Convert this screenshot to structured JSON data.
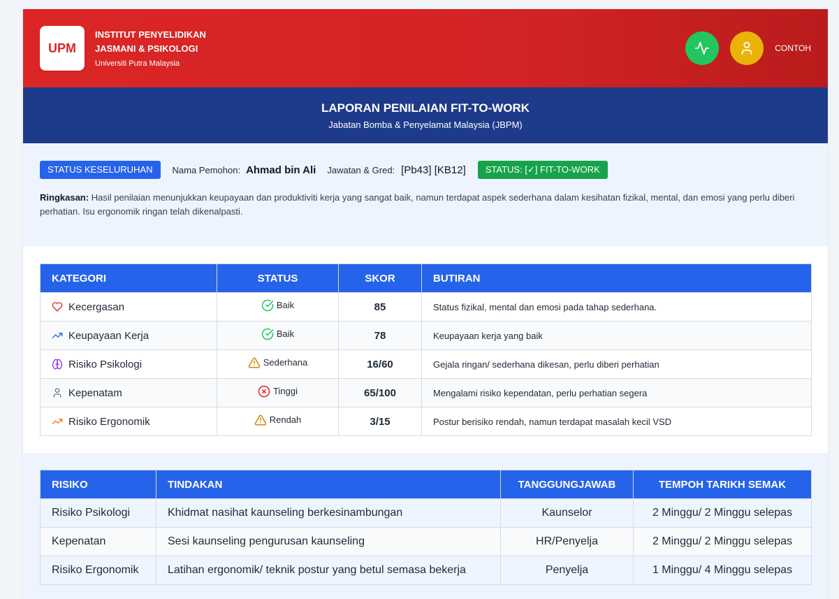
{
  "header": {
    "logo_text": "UPM",
    "institute_line1": "INSTITUT PENYELIDIKAN",
    "institute_line2": "JASMANI & PSIKOLOGI",
    "university": "Universiti Putra Malaysia",
    "activity_button_icon": "activity-icon",
    "profile_button_icon": "user-icon",
    "user_label": "CONTOH"
  },
  "report": {
    "title": "LAPORAN PENILAIAN FIT-TO-WORK",
    "subtitle": "Jabatan Bomba & Penyelamat Malaysia (JBPM)"
  },
  "overview": {
    "badge": "STATUS KESELURUHAN",
    "applicant_label": "Nama Pemohon:",
    "applicant_name": "Ahmad bin Ali",
    "position_label": "Jawatan & Gred:",
    "position_value": "[Pb43] [KB12]",
    "status_badge": "STATUS: [✓] FIT-TO-WORK",
    "summary_label": "Ringkasan:",
    "summary_text": "Hasil penilaian menunjukkan keupayaan dan produktiviti kerja yang sangat baik, namun terdapat aspek sederhana dalam kesihatan fizikal, mental, dan emosi yang perlu diberi perhatian. Isu ergonomik ringan telah dikenalpasti."
  },
  "assessment_table": {
    "headers": {
      "category": "KATEGORI",
      "status": "STATUS",
      "score": "SKOR",
      "details": "BUTIRAN"
    },
    "rows": [
      {
        "category": "Kecergasan",
        "category_icon": "heart-icon",
        "status": "Baik",
        "status_icon": "check-circle-icon",
        "score": "85",
        "details": "Status fizikal, mental dan emosi pada tahap sederhana."
      },
      {
        "category": "Keupayaan Kerja",
        "category_icon": "trending-up-icon",
        "status": "Baik",
        "status_icon": "check-circle-icon",
        "score": "78",
        "details": "Keupayaan kerja yang baik"
      },
      {
        "category": "Risiko Psikologi",
        "category_icon": "brain-icon",
        "status": "Sederhana",
        "status_icon": "warning-triangle-icon",
        "score": "16/60",
        "details": "Gejala ringan/ sederhana dikesan, perlu diberi perhatian"
      },
      {
        "category": "Kepenatam",
        "category_icon": "user-icon",
        "status": "Tinggi",
        "status_icon": "x-circle-icon",
        "score": "65/100",
        "details": "Mengalami risiko kependatan, perlu perhatian segera"
      },
      {
        "category": "Risiko Ergonomik",
        "category_icon": "trending-up-icon",
        "status": "Rendah",
        "status_icon": "warning-triangle-icon",
        "score": "3/15",
        "details": "Postur berisiko rendah, namun terdapat masalah kecil VSD"
      }
    ]
  },
  "action_table": {
    "headers": {
      "risk": "RISIKO",
      "action": "TINDAKAN",
      "responsible": "TANGGUNGJAWAB",
      "review_period": "TEMPOH TARIKH SEMAK"
    },
    "rows": [
      {
        "risk": "Risiko Psikologi",
        "action": "Khidmat nasihat kaunseling berkesinambungan",
        "responsible": "Kaunselor",
        "review_period": "2 Minggu/ 2 Minggu selepas"
      },
      {
        "risk": "Kepenatan",
        "action": "Sesi kaunseling pengurusan kaunseling",
        "responsible": "HR/Penyelja",
        "review_period": "2 Minggu/ 2 Minggu selepas"
      },
      {
        "risk": "Risiko Ergonomik",
        "action": "Latihan ergonomik/ teknik postur yang betul semasa bekerja",
        "responsible": "Penyelja",
        "review_period": "1 Minggu/ 4 Minggu selepas"
      }
    ]
  },
  "colors": {
    "header_red": "#dc2626",
    "header_red_dark": "#b91c1c",
    "navy_band": "#1e3a8a",
    "accent_blue": "#2563eb",
    "fit_green": "#16a34a",
    "activity_green": "#22c55e",
    "profile_yellow": "#eab308",
    "section_tint": "#eef4fd"
  }
}
